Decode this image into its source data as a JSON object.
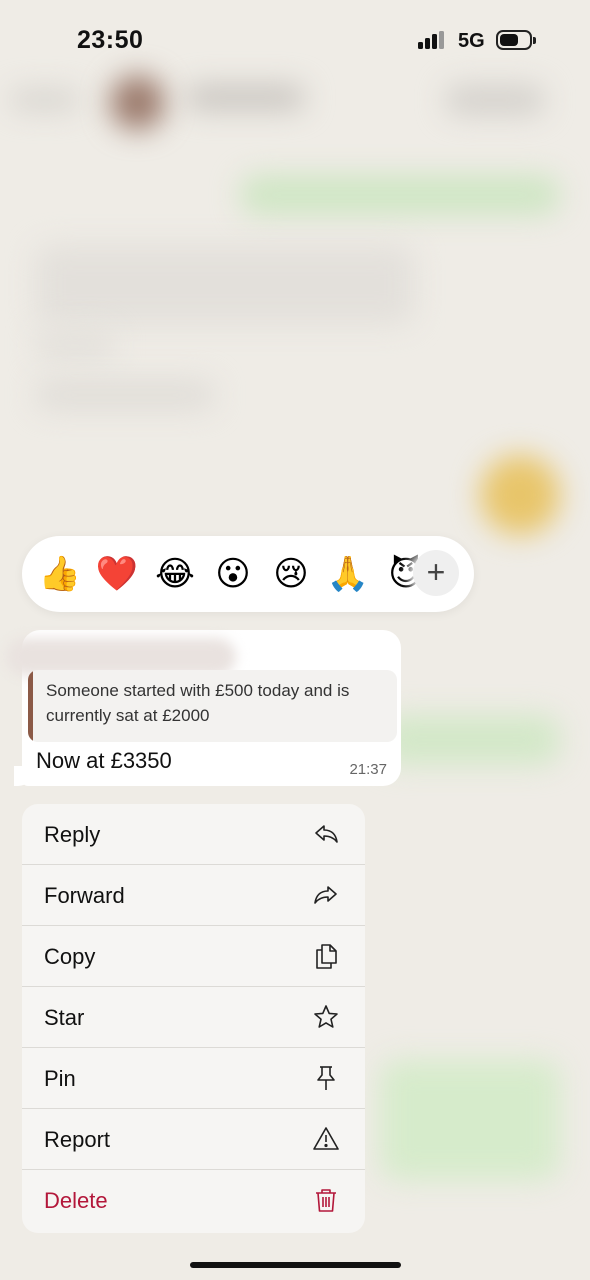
{
  "status_bar": {
    "time": "23:50",
    "network": "5G"
  },
  "reactions": {
    "emojis": [
      "👍",
      "❤️",
      "😂",
      "😮",
      "😢",
      "🙏",
      "😈"
    ],
    "more_label": "+"
  },
  "message": {
    "quoted_text": "Someone started with £500 today and is currently sat at £2000",
    "text": "Now at £3350",
    "time": "21:37"
  },
  "menu": {
    "items": [
      {
        "label": "Reply",
        "icon": "reply-icon"
      },
      {
        "label": "Forward",
        "icon": "forward-icon"
      },
      {
        "label": "Copy",
        "icon": "copy-icon"
      },
      {
        "label": "Star",
        "icon": "star-icon"
      },
      {
        "label": "Pin",
        "icon": "pin-icon"
      },
      {
        "label": "Report",
        "icon": "report-icon"
      },
      {
        "label": "Delete",
        "icon": "trash-icon"
      }
    ]
  },
  "colors": {
    "danger": "#b3173a",
    "quote_bar": "#8b5a47",
    "background": "#efece6"
  }
}
